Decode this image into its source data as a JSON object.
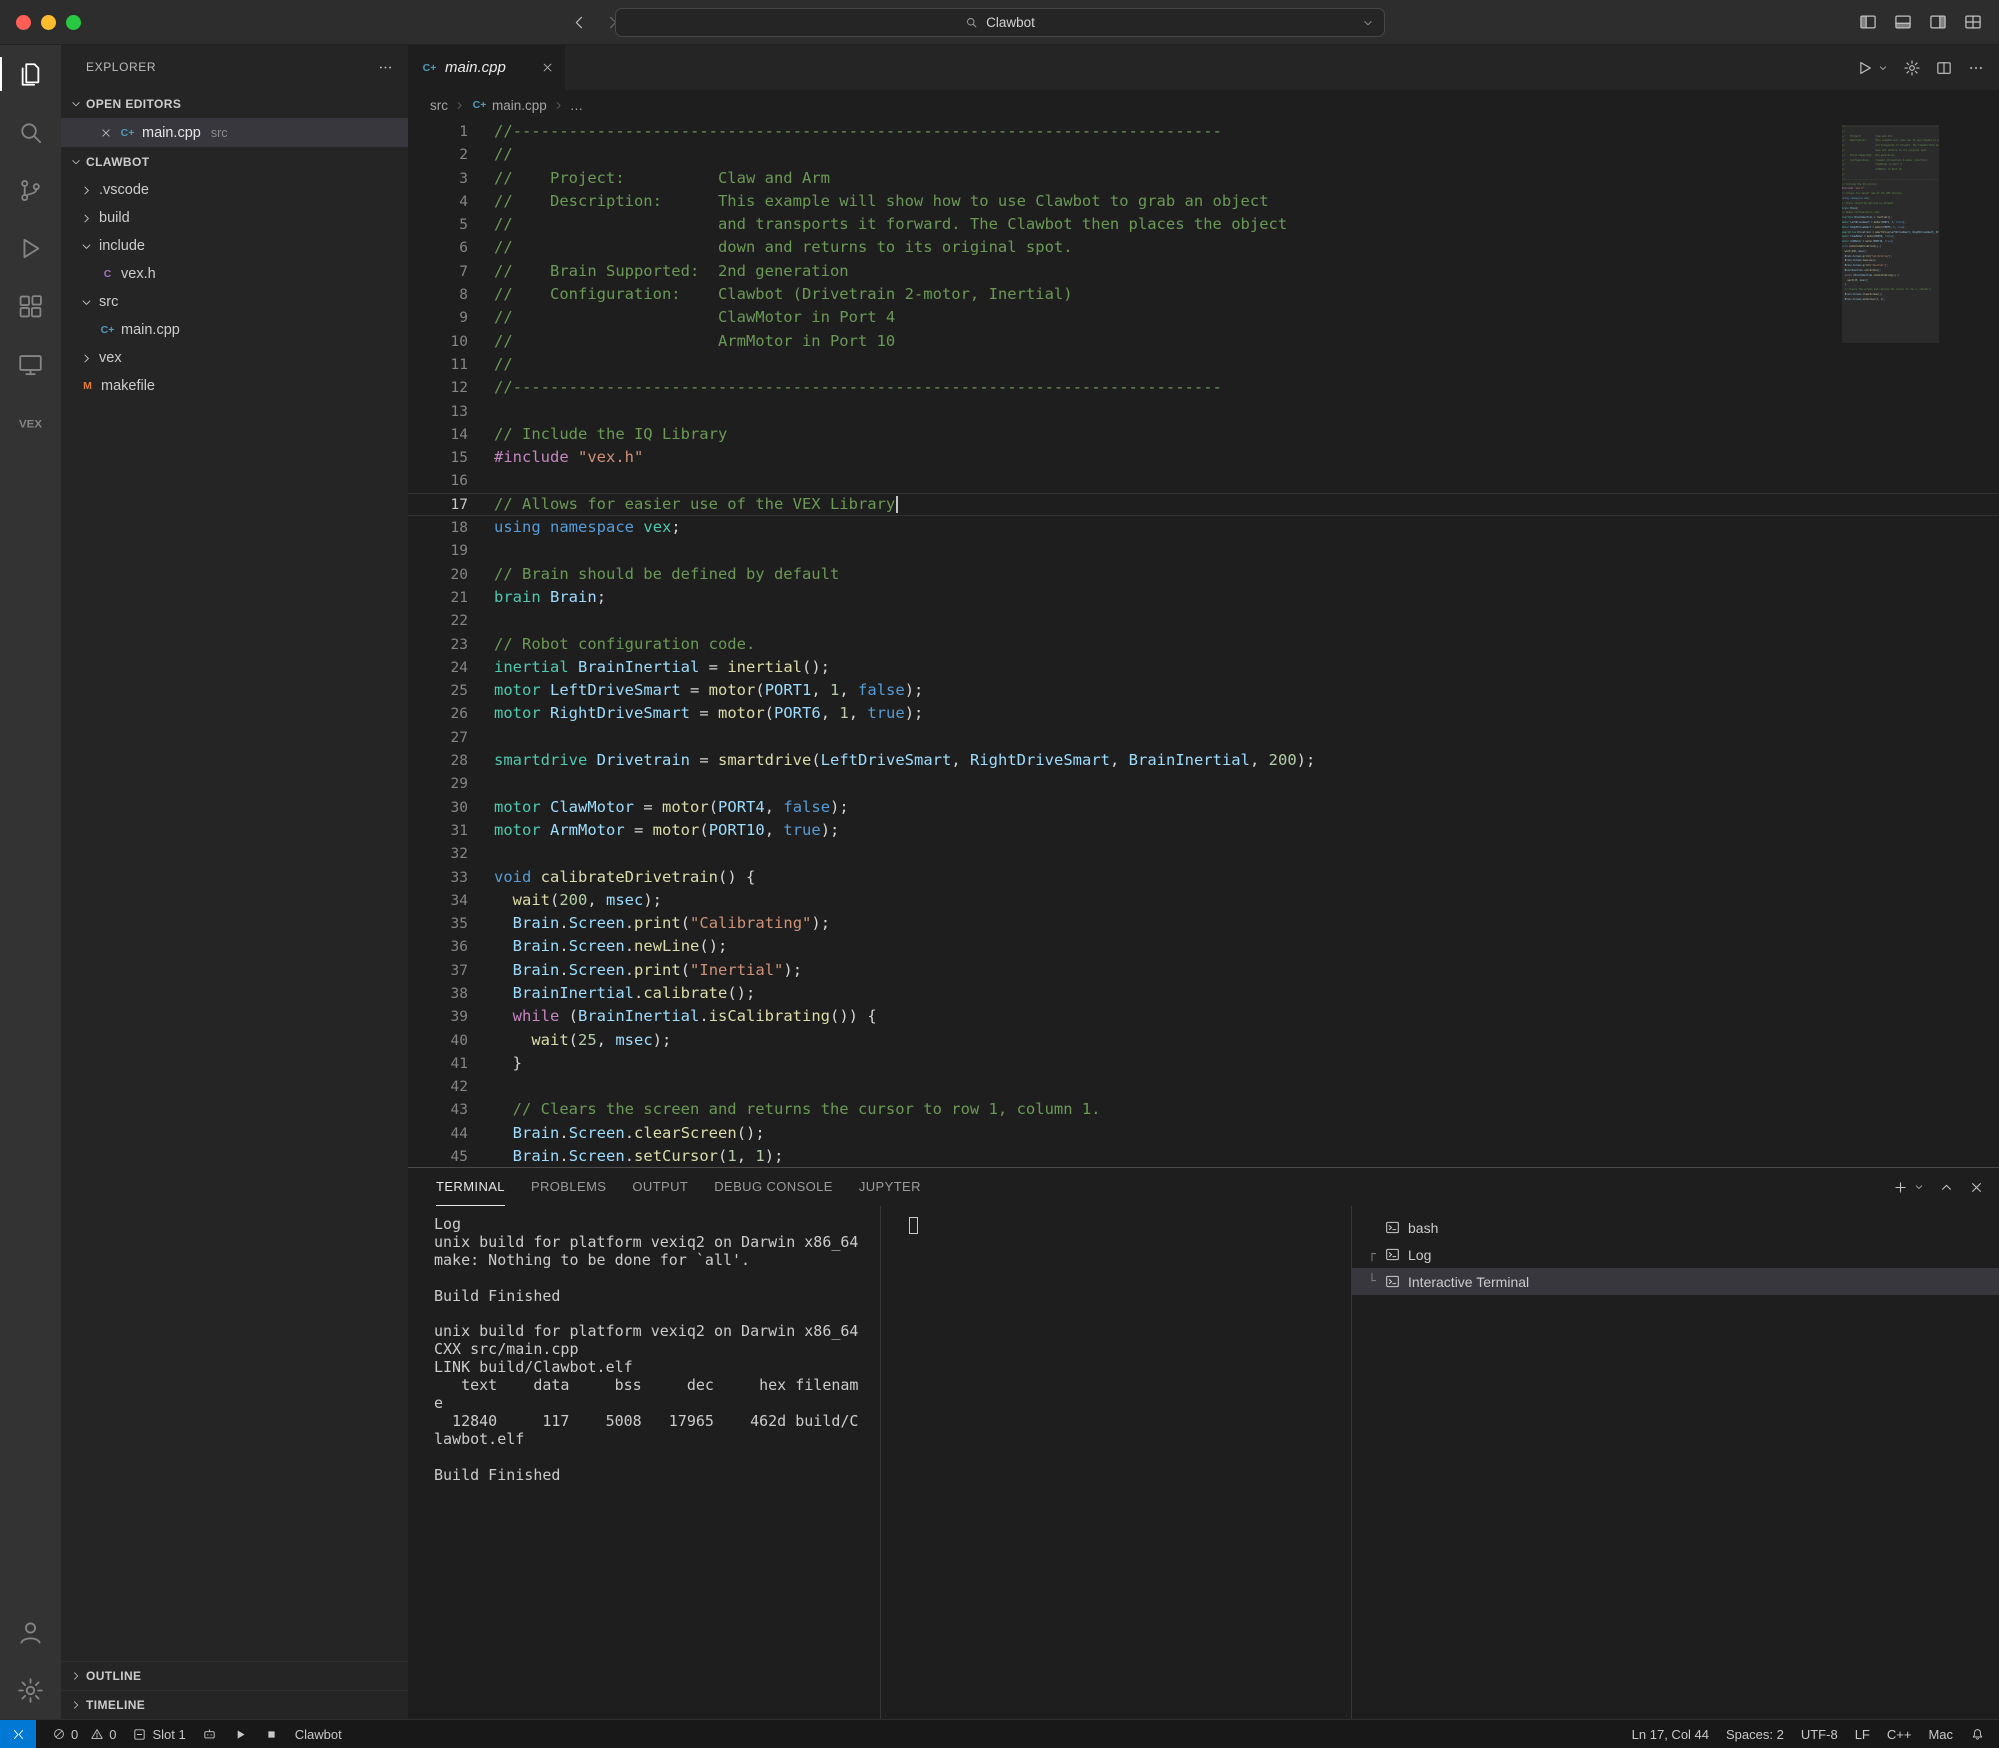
{
  "window": {
    "search_label": "Clawbot"
  },
  "colors": {
    "accent": "#0078d4",
    "cpp_icon": "#519aba",
    "h_icon": "#a074c4",
    "makefile_icon": "#e37933"
  },
  "activity_bar": {
    "items": [
      {
        "id": "explorer",
        "icon": "explorer",
        "active": true
      },
      {
        "id": "search",
        "icon": "search",
        "active": false
      },
      {
        "id": "source-control",
        "icon": "source-control",
        "active": false
      },
      {
        "id": "run-debug",
        "icon": "run-debug",
        "active": false
      },
      {
        "id": "extensions",
        "icon": "extensions",
        "active": false
      },
      {
        "id": "remote-explorer",
        "icon": "remote-explorer",
        "active": false
      },
      {
        "id": "vex",
        "icon": "vex",
        "active": false
      }
    ],
    "bottom": [
      {
        "id": "accounts",
        "icon": "account"
      },
      {
        "id": "settings",
        "icon": "gear"
      }
    ]
  },
  "sidebar": {
    "title": "EXPLORER",
    "open_editors": {
      "label": "OPEN EDITORS",
      "items": [
        {
          "name": "main.cpp",
          "detail": "src",
          "ficon": "cpp"
        }
      ]
    },
    "project": {
      "label": "CLAWBOT",
      "tree": [
        {
          "label": ".vscode",
          "type": "folder",
          "expanded": false,
          "level": 1
        },
        {
          "label": "build",
          "type": "folder",
          "expanded": false,
          "level": 1
        },
        {
          "label": "include",
          "type": "folder",
          "expanded": true,
          "level": 1
        },
        {
          "label": "vex.h",
          "type": "file",
          "ficon": "h",
          "level": 2
        },
        {
          "label": "src",
          "type": "folder",
          "expanded": true,
          "level": 1
        },
        {
          "label": "main.cpp",
          "type": "file",
          "ficon": "cpp",
          "level": 2
        },
        {
          "label": "vex",
          "type": "folder",
          "expanded": false,
          "level": 1
        },
        {
          "label": "makefile",
          "type": "file",
          "ficon": "m",
          "level": 1
        }
      ]
    },
    "sections": [
      "OUTLINE",
      "TIMELINE"
    ]
  },
  "editor": {
    "tab": {
      "name": "main.cpp",
      "ficon": "cpp"
    },
    "breadcrumb": [
      {
        "label": "src"
      },
      {
        "label": "main.cpp",
        "ficon": "cpp"
      },
      {
        "label": "…"
      }
    ],
    "current_line": 17,
    "cursor_col": 44,
    "lines": [
      [
        [
          "//----------------------------------------------------------------------------",
          "c"
        ]
      ],
      [
        [
          "//",
          "c"
        ]
      ],
      [
        [
          "//    Project:          Claw and Arm",
          "c"
        ]
      ],
      [
        [
          "//    Description:      This example will show how to use Clawbot to grab an object",
          "c"
        ]
      ],
      [
        [
          "//                      and transports it forward. The Clawbot then places the object",
          "c"
        ]
      ],
      [
        [
          "//                      down and returns to its original spot.",
          "c"
        ]
      ],
      [
        [
          "//    Brain Supported:  2nd generation",
          "c"
        ]
      ],
      [
        [
          "//    Configuration:    Clawbot (Drivetrain 2-motor, Inertial)",
          "c"
        ]
      ],
      [
        [
          "//                      ClawMotor in Port 4",
          "c"
        ]
      ],
      [
        [
          "//                      ArmMotor in Port 10",
          "c"
        ]
      ],
      [
        [
          "//",
          "c"
        ]
      ],
      [
        [
          "//----------------------------------------------------------------------------",
          "c"
        ]
      ],
      [],
      [
        [
          "// Include the IQ Library",
          "c"
        ]
      ],
      [
        [
          "#include",
          "d"
        ],
        [
          " ",
          "p"
        ],
        [
          "\"vex.h\"",
          "s"
        ]
      ],
      [],
      [
        [
          "// Allows for easier use of the VEX Library",
          "c"
        ]
      ],
      [
        [
          "using",
          "k"
        ],
        [
          " ",
          "p"
        ],
        [
          "namespace",
          "k"
        ],
        [
          " ",
          "p"
        ],
        [
          "vex",
          "t"
        ],
        [
          ";",
          "p"
        ]
      ],
      [],
      [
        [
          "// Brain should be defined by default",
          "c"
        ]
      ],
      [
        [
          "brain",
          "t"
        ],
        [
          " ",
          "p"
        ],
        [
          "Brain",
          "v"
        ],
        [
          ";",
          "p"
        ]
      ],
      [],
      [
        [
          "// Robot configuration code.",
          "c"
        ]
      ],
      [
        [
          "inertial",
          "t"
        ],
        [
          " ",
          "p"
        ],
        [
          "BrainInertial",
          "v"
        ],
        [
          " = ",
          "p"
        ],
        [
          "inertial",
          "f"
        ],
        [
          "();",
          "p"
        ]
      ],
      [
        [
          "motor",
          "t"
        ],
        [
          " ",
          "p"
        ],
        [
          "LeftDriveSmart",
          "v"
        ],
        [
          " = ",
          "p"
        ],
        [
          "motor",
          "f"
        ],
        [
          "(",
          "p"
        ],
        [
          "PORT1",
          "v"
        ],
        [
          ", ",
          "p"
        ],
        [
          "1",
          "n"
        ],
        [
          ", ",
          "p"
        ],
        [
          "false",
          "k"
        ],
        [
          ");",
          "p"
        ]
      ],
      [
        [
          "motor",
          "t"
        ],
        [
          " ",
          "p"
        ],
        [
          "RightDriveSmart",
          "v"
        ],
        [
          " = ",
          "p"
        ],
        [
          "motor",
          "f"
        ],
        [
          "(",
          "p"
        ],
        [
          "PORT6",
          "v"
        ],
        [
          ", ",
          "p"
        ],
        [
          "1",
          "n"
        ],
        [
          ", ",
          "p"
        ],
        [
          "true",
          "k"
        ],
        [
          ");",
          "p"
        ]
      ],
      [],
      [
        [
          "smartdrive",
          "t"
        ],
        [
          " ",
          "p"
        ],
        [
          "Drivetrain",
          "v"
        ],
        [
          " = ",
          "p"
        ],
        [
          "smartdrive",
          "f"
        ],
        [
          "(",
          "p"
        ],
        [
          "LeftDriveSmart",
          "v"
        ],
        [
          ", ",
          "p"
        ],
        [
          "RightDriveSmart",
          "v"
        ],
        [
          ", ",
          "p"
        ],
        [
          "BrainInertial",
          "v"
        ],
        [
          ", ",
          "p"
        ],
        [
          "200",
          "n"
        ],
        [
          ");",
          "p"
        ]
      ],
      [],
      [
        [
          "motor",
          "t"
        ],
        [
          " ",
          "p"
        ],
        [
          "ClawMotor",
          "v"
        ],
        [
          " = ",
          "p"
        ],
        [
          "motor",
          "f"
        ],
        [
          "(",
          "p"
        ],
        [
          "PORT4",
          "v"
        ],
        [
          ", ",
          "p"
        ],
        [
          "false",
          "k"
        ],
        [
          ");",
          "p"
        ]
      ],
      [
        [
          "motor",
          "t"
        ],
        [
          " ",
          "p"
        ],
        [
          "ArmMotor",
          "v"
        ],
        [
          " = ",
          "p"
        ],
        [
          "motor",
          "f"
        ],
        [
          "(",
          "p"
        ],
        [
          "PORT10",
          "v"
        ],
        [
          ", ",
          "p"
        ],
        [
          "true",
          "k"
        ],
        [
          ");",
          "p"
        ]
      ],
      [],
      [
        [
          "void",
          "k"
        ],
        [
          " ",
          "p"
        ],
        [
          "calibrateDrivetrain",
          "f"
        ],
        [
          "() {",
          "p"
        ]
      ],
      [
        [
          "  ",
          "p"
        ],
        [
          "wait",
          "f"
        ],
        [
          "(",
          "p"
        ],
        [
          "200",
          "n"
        ],
        [
          ", ",
          "p"
        ],
        [
          "msec",
          "v"
        ],
        [
          ");",
          "p"
        ]
      ],
      [
        [
          "  ",
          "p"
        ],
        [
          "Brain",
          "v"
        ],
        [
          ".",
          "p"
        ],
        [
          "Screen",
          "v"
        ],
        [
          ".",
          "p"
        ],
        [
          "print",
          "f"
        ],
        [
          "(",
          "p"
        ],
        [
          "\"Calibrating\"",
          "s"
        ],
        [
          ");",
          "p"
        ]
      ],
      [
        [
          "  ",
          "p"
        ],
        [
          "Brain",
          "v"
        ],
        [
          ".",
          "p"
        ],
        [
          "Screen",
          "v"
        ],
        [
          ".",
          "p"
        ],
        [
          "newLine",
          "f"
        ],
        [
          "();",
          "p"
        ]
      ],
      [
        [
          "  ",
          "p"
        ],
        [
          "Brain",
          "v"
        ],
        [
          ".",
          "p"
        ],
        [
          "Screen",
          "v"
        ],
        [
          ".",
          "p"
        ],
        [
          "print",
          "f"
        ],
        [
          "(",
          "p"
        ],
        [
          "\"Inertial\"",
          "s"
        ],
        [
          ");",
          "p"
        ]
      ],
      [
        [
          "  ",
          "p"
        ],
        [
          "BrainInertial",
          "v"
        ],
        [
          ".",
          "p"
        ],
        [
          "calibrate",
          "f"
        ],
        [
          "();",
          "p"
        ]
      ],
      [
        [
          "  ",
          "p"
        ],
        [
          "while",
          "w"
        ],
        [
          " (",
          "p"
        ],
        [
          "BrainInertial",
          "v"
        ],
        [
          ".",
          "p"
        ],
        [
          "isCalibrating",
          "f"
        ],
        [
          "()) {",
          "p"
        ]
      ],
      [
        [
          "    ",
          "p"
        ],
        [
          "wait",
          "f"
        ],
        [
          "(",
          "p"
        ],
        [
          "25",
          "n"
        ],
        [
          ", ",
          "p"
        ],
        [
          "msec",
          "v"
        ],
        [
          ");",
          "p"
        ]
      ],
      [
        [
          "  }",
          "p"
        ]
      ],
      [],
      [
        [
          "  // Clears the screen and returns the cursor to row 1, column 1.",
          "c"
        ]
      ],
      [
        [
          "  ",
          "p"
        ],
        [
          "Brain",
          "v"
        ],
        [
          ".",
          "p"
        ],
        [
          "Screen",
          "v"
        ],
        [
          ".",
          "p"
        ],
        [
          "clearScreen",
          "f"
        ],
        [
          "();",
          "p"
        ]
      ],
      [
        [
          "  ",
          "p"
        ],
        [
          "Brain",
          "v"
        ],
        [
          ".",
          "p"
        ],
        [
          "Screen",
          "v"
        ],
        [
          ".",
          "p"
        ],
        [
          "setCursor",
          "f"
        ],
        [
          "(",
          "p"
        ],
        [
          "1",
          "n"
        ],
        [
          ", ",
          "p"
        ],
        [
          "1",
          "n"
        ],
        [
          ");",
          "p"
        ]
      ]
    ]
  },
  "panel": {
    "tabs": [
      {
        "label": "TERMINAL",
        "active": true
      },
      {
        "label": "PROBLEMS",
        "active": false
      },
      {
        "label": "OUTPUT",
        "active": false
      },
      {
        "label": "DEBUG CONSOLE",
        "active": false
      },
      {
        "label": "JUPYTER",
        "active": false
      }
    ],
    "terminal_output": [
      "Log",
      "unix build for platform vexiq2 on Darwin x86_64",
      "make: Nothing to be done for `all'.",
      "",
      "Build Finished",
      "",
      "unix build for platform vexiq2 on Darwin x86_64",
      "CXX src/main.cpp",
      "LINK build/Clawbot.elf",
      "   text    data     bss     dec     hex filenam",
      "e",
      "  12840     117    5008   17965    462d build/C",
      "lawbot.elf",
      "",
      "Build Finished"
    ],
    "terminals": [
      {
        "label": "bash",
        "connector": "",
        "selected": false
      },
      {
        "label": "Log",
        "connector": "┌",
        "selected": false
      },
      {
        "label": "Interactive Terminal",
        "connector": "└",
        "selected": true
      }
    ]
  },
  "status_bar": {
    "errors": "0",
    "warnings": "0",
    "slot": "Slot 1",
    "project": "Clawbot",
    "line_col": "Ln 17, Col 44",
    "indent": "Spaces: 2",
    "encoding": "UTF-8",
    "eol": "LF",
    "language": "C++",
    "platform": "Mac"
  }
}
